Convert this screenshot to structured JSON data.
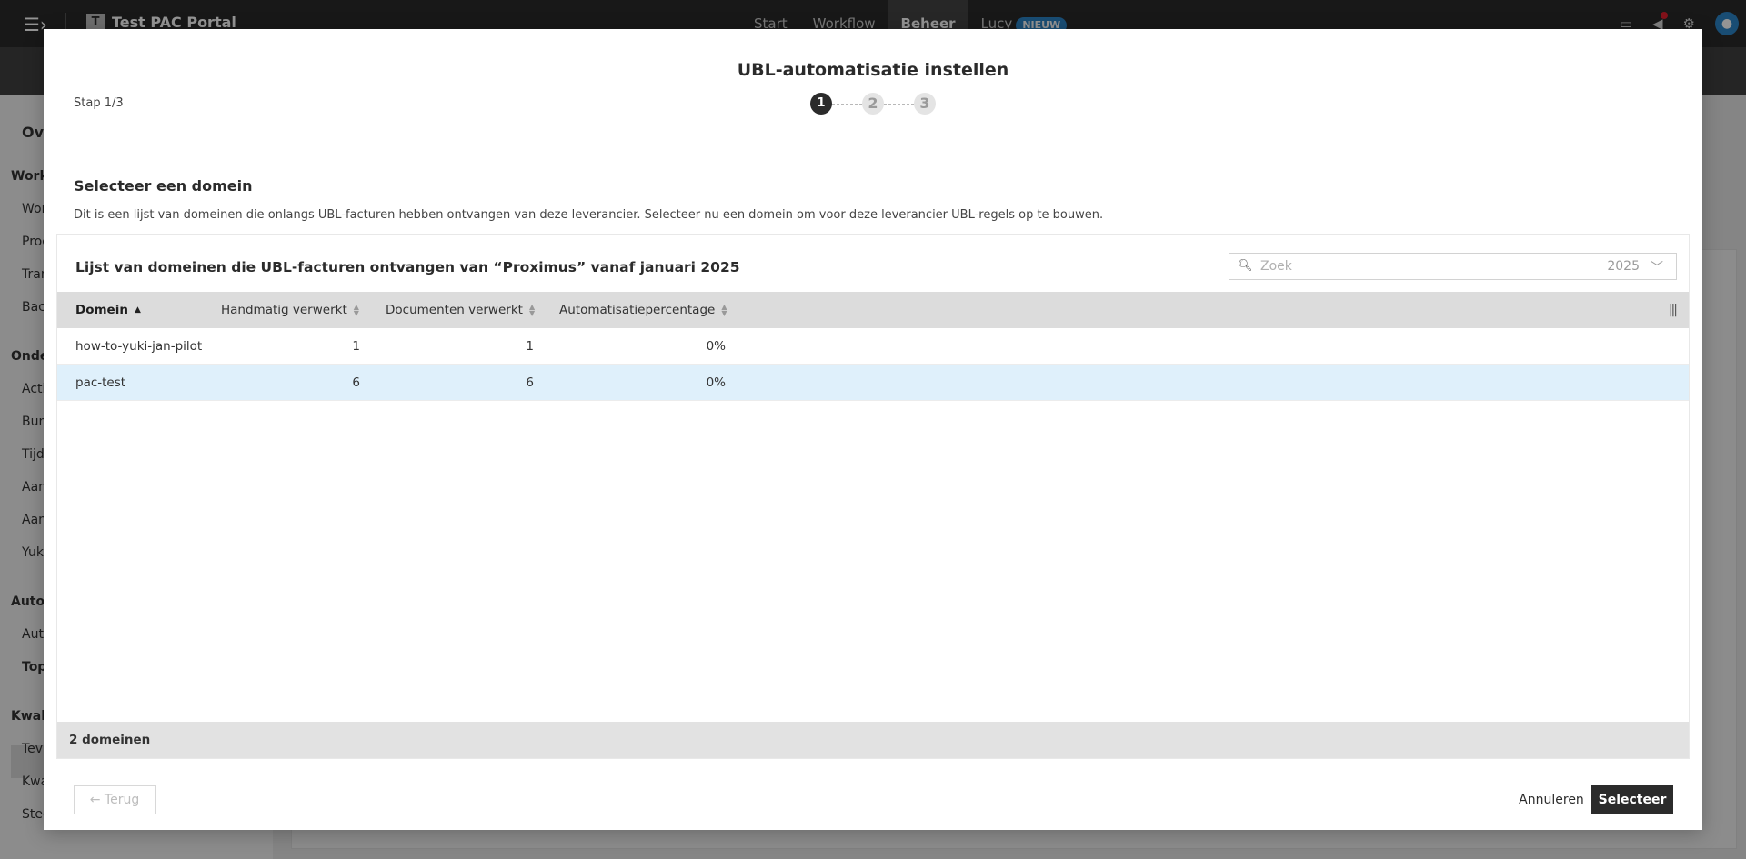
{
  "app": {
    "title": "Test PAC Portal",
    "logo_letter": "T",
    "nav": [
      {
        "label": "Start"
      },
      {
        "label": "Workflow"
      },
      {
        "label": "Beheer"
      },
      {
        "label": "Lucy",
        "badge": "NIEUW"
      }
    ]
  },
  "sidebar": {
    "items": [
      "Ove",
      "Work",
      "Wor",
      "Proc",
      "Tran",
      "Bac",
      "Onde",
      "Acti",
      "Bun",
      "Tijd",
      "Aan",
      "Aan",
      "Yuki",
      "Autor",
      "Aut",
      "Top",
      "Kwali",
      "Tevr",
      "Kwa",
      "Stee"
    ]
  },
  "modal": {
    "title": "UBL-automatisatie instellen",
    "step_label": "Stap 1/3",
    "steps": [
      "1",
      "2",
      "3"
    ],
    "section_title": "Selecteer een domein",
    "section_desc": "Dit is een lijst van domeinen die onlangs UBL-facturen hebben ontvangen van deze leverancier. Selecteer nu een domein om voor deze leverancier UBL-regels op te bouwen.",
    "panel_title": "Lijst van domeinen die UBL-facturen ontvangen van “Proximus” vanaf januari 2025",
    "search": {
      "placeholder": "Zoek",
      "year": "2025"
    },
    "table": {
      "columns": [
        "Domein",
        "Handmatig verwerkt",
        "Documenten verwerkt",
        "Automatisatiepercentage"
      ],
      "rows": [
        {
          "domain": "how-to-yuki-jan-pilot",
          "manual": "1",
          "docs": "1",
          "pct": "0%"
        },
        {
          "domain": "pac-test",
          "manual": "6",
          "docs": "6",
          "pct": "0%"
        }
      ],
      "footer": "2 domeinen"
    },
    "buttons": {
      "back": "← Terug",
      "cancel": "Annuleren",
      "select": "Selecteer"
    }
  },
  "colors": {
    "accent": "#2b2b2b",
    "selected_row": "#dff0fb",
    "badge": "#2c85c8"
  }
}
